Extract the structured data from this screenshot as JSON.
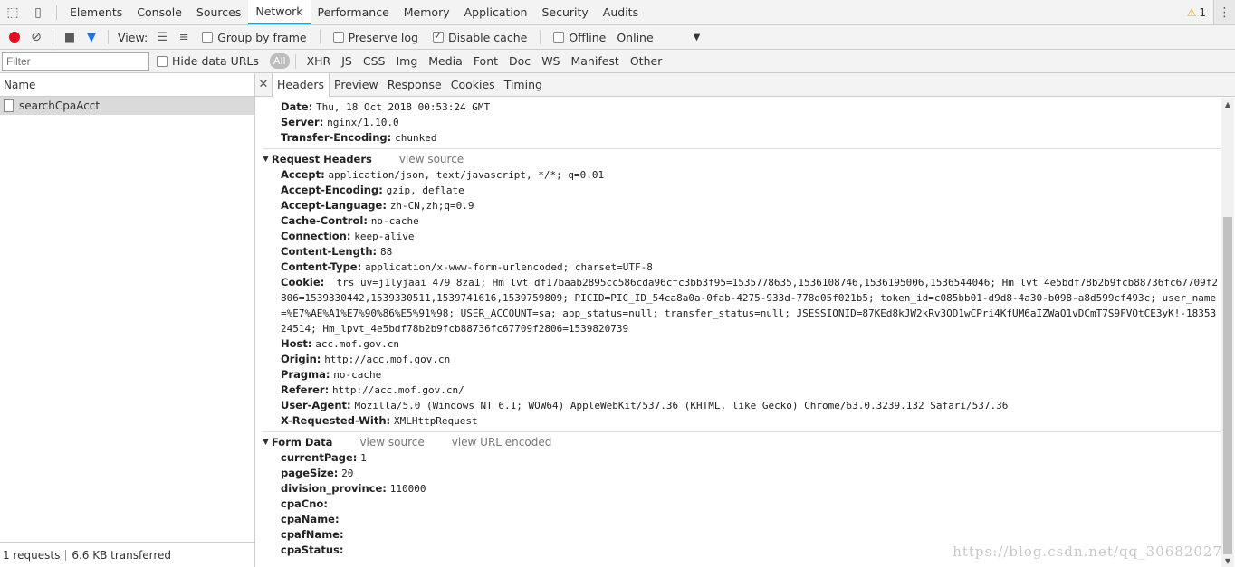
{
  "devtools": {
    "tabs": [
      "Elements",
      "Console",
      "Sources",
      "Network",
      "Performance",
      "Memory",
      "Application",
      "Security",
      "Audits"
    ],
    "active_tab": "Network",
    "warning_count": "1"
  },
  "toolbar": {
    "view_label": "View:",
    "group_by_frame": "Group by frame",
    "preserve_log": "Preserve log",
    "disable_cache": "Disable cache",
    "offline": "Offline",
    "throttle": "Online"
  },
  "filterbar": {
    "filter_placeholder": "Filter",
    "hide_data_urls": "Hide data URLs",
    "types": [
      "All",
      "XHR",
      "JS",
      "CSS",
      "Img",
      "Media",
      "Font",
      "Doc",
      "WS",
      "Manifest",
      "Other"
    ]
  },
  "requests": {
    "name_header": "Name",
    "items": [
      "searchCpaAcct"
    ],
    "status_count": "1 requests",
    "status_transferred": "6.6 KB transferred"
  },
  "detail": {
    "tabs": [
      "Headers",
      "Preview",
      "Response",
      "Cookies",
      "Timing"
    ],
    "response_headers": [
      {
        "name": "Date:",
        "value": "Thu, 18 Oct 2018 00:53:24 GMT"
      },
      {
        "name": "Server:",
        "value": "nginx/1.10.0"
      },
      {
        "name": "Transfer-Encoding:",
        "value": "chunked"
      }
    ],
    "request_headers_title": "Request Headers",
    "view_source": "view source",
    "request_headers": [
      {
        "name": "Accept:",
        "value": "application/json, text/javascript, */*; q=0.01"
      },
      {
        "name": "Accept-Encoding:",
        "value": "gzip, deflate"
      },
      {
        "name": "Accept-Language:",
        "value": "zh-CN,zh;q=0.9"
      },
      {
        "name": "Cache-Control:",
        "value": "no-cache"
      },
      {
        "name": "Connection:",
        "value": "keep-alive"
      },
      {
        "name": "Content-Length:",
        "value": "88"
      },
      {
        "name": "Content-Type:",
        "value": "application/x-www-form-urlencoded; charset=UTF-8"
      }
    ],
    "cookie_name": "Cookie:",
    "cookie_value": "_trs_uv=j1lyjaai_479_8za1; Hm_lvt_df17baab2895cc586cda96cfc3bb3f95=1535778635,1536108746,1536195006,1536544046; Hm_lvt_4e5bdf78b2b9fcb88736fc67709f2806=1539330442,1539330511,1539741616,1539759809; PICID=PIC_ID_54ca8a0a-0fab-4275-933d-778d05f021b5; token_id=c085bb01-d9d8-4a30-b098-a8d599cf493c; user_name=%E7%AE%A1%E7%90%86%E5%91%98; USER_ACCOUNT=sa; app_status=null; transfer_status=null; JSESSIONID=87KEd8kJW2kRv3QD1wCPri4KfUM6aIZWaQ1vDCmT7S9FVOtCE3yK!-1835324514; Hm_lpvt_4e5bdf78b2b9fcb88736fc67709f2806=1539820739",
    "request_headers_2": [
      {
        "name": "Host:",
        "value": "acc.mof.gov.cn"
      },
      {
        "name": "Origin:",
        "value": "http://acc.mof.gov.cn"
      },
      {
        "name": "Pragma:",
        "value": "no-cache"
      },
      {
        "name": "Referer:",
        "value": "http://acc.mof.gov.cn/"
      },
      {
        "name": "User-Agent:",
        "value": "Mozilla/5.0 (Windows NT 6.1; WOW64) AppleWebKit/537.36 (KHTML, like Gecko) Chrome/63.0.3239.132 Safari/537.36"
      },
      {
        "name": "X-Requested-With:",
        "value": "XMLHttpRequest"
      }
    ],
    "form_data_title": "Form Data",
    "view_url_encoded": "view URL encoded",
    "form_data": [
      {
        "name": "currentPage:",
        "value": "1"
      },
      {
        "name": "pageSize:",
        "value": "20"
      },
      {
        "name": "division_province:",
        "value": "110000"
      },
      {
        "name": "cpaCno:",
        "value": ""
      },
      {
        "name": "cpaName:",
        "value": ""
      },
      {
        "name": "cpafName:",
        "value": ""
      },
      {
        "name": "cpaStatus:",
        "value": ""
      }
    ]
  },
  "watermark": "https://blog.csdn.net/qq_30682027"
}
